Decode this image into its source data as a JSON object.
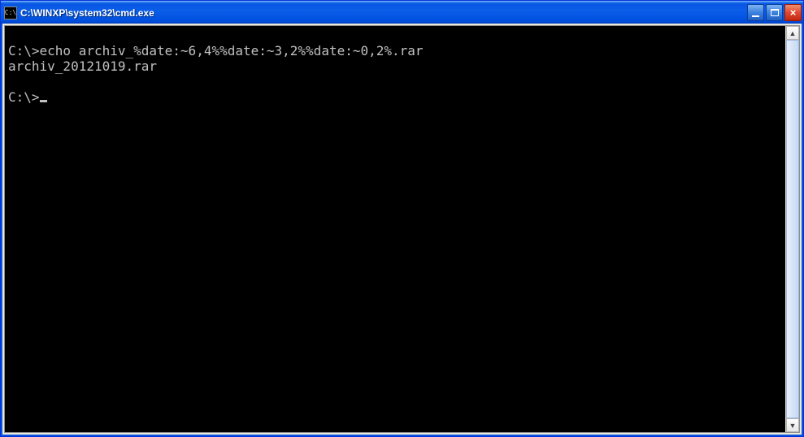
{
  "titlebar": {
    "icon_text": "C:\\",
    "title": "C:\\WINXP\\system32\\cmd.exe"
  },
  "console": {
    "line1": "C:\\>echo archiv_%date:~6,4%%date:~3,2%%date:~0,2%.rar",
    "line2": "archiv_20121019.rar",
    "blank": "",
    "prompt": "C:\\>"
  }
}
